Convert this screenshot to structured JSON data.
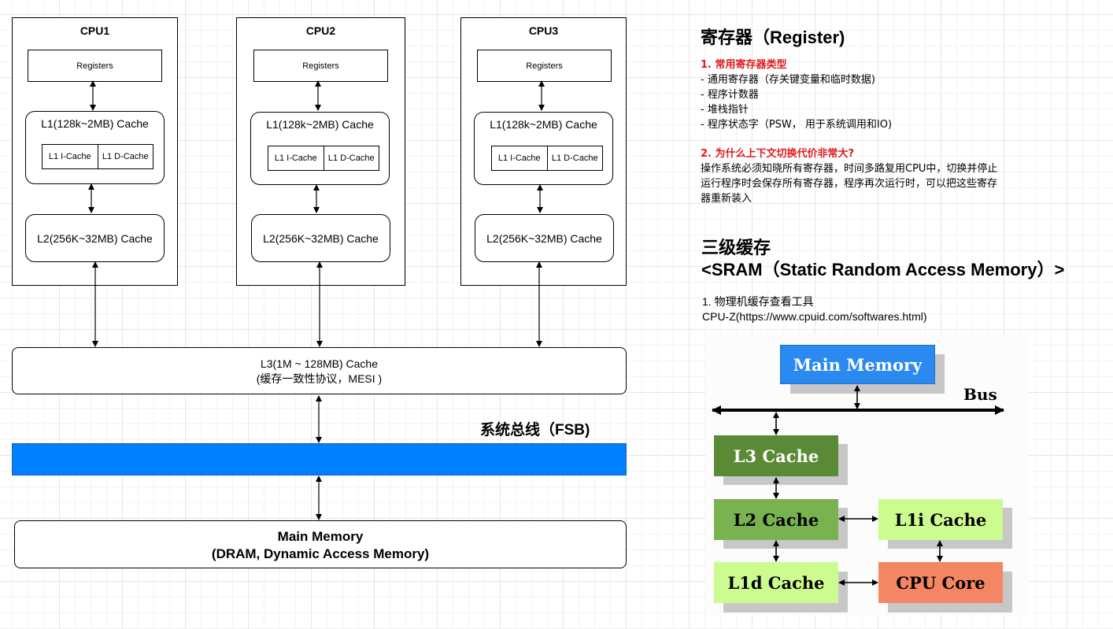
{
  "cpus": [
    {
      "title": "CPU1",
      "registers": "Registers",
      "l1": "L1(128k~2MB) Cache",
      "l1i": "L1 I-Cache",
      "l1d": "L1 D-Cache",
      "l2": "L2(256K~32MB) Cache"
    },
    {
      "title": "CPU2",
      "registers": "Registers",
      "l1": "L1(128k~2MB) Cache",
      "l1i": "L1 I-Cache",
      "l1d": "L1 D-Cache",
      "l2": "L2(256K~32MB) Cache"
    },
    {
      "title": "CPU3",
      "registers": "Registers",
      "l1": "L1(128k~2MB) Cache",
      "l1i": "L1 I-Cache",
      "l1d": "L1 D-Cache",
      "l2": "L2(256K~32MB) Cache"
    }
  ],
  "l3": {
    "line1": "L3(1M ~ 128MB) Cache",
    "line2": "(缓存一致性协议，MESI )"
  },
  "fsb_label": "系统总线（FSB)",
  "main_memory": {
    "line1": "Main Memory",
    "line2": "(DRAM, Dynamic Access Memory)"
  },
  "notes": {
    "register_heading": "寄存器（Register)",
    "sec1_title": "1. 常用寄存器类型",
    "sec1_items": [
      "- 通用寄存器（存关键变量和临时数据)",
      "- 程序计数器",
      "- 堆栈指针",
      "- 程序状态字（PSW，  用于系统调用和IO)"
    ],
    "sec2_title": "2. 为什么上下文切换代价非常大?",
    "sec2_lines": [
      "操作系统必须知晓所有寄存器，时间多路复用CPU中，切换并停止",
      "运行程序时会保存所有寄存器，程序再次运行时，可以把这些寄存",
      "器重新装入"
    ],
    "cache_heading1": "三级缓存",
    "cache_heading2": "<SRAM（Static Random Access Memory）>",
    "tool_line1": "1. 物理机缓存查看工具",
    "tool_line2": "CPU-Z(https://www.cpuid.com/softwares.html)"
  },
  "inset": {
    "main_memory": "Main Memory",
    "bus": "Bus",
    "l3": "L3 Cache",
    "l2": "L2 Cache",
    "l1i": "L1i Cache",
    "l1d": "L1d Cache",
    "cpu_core": "CPU Core",
    "colors": {
      "main_memory": "#2b8af0",
      "l3": "#5a8a36",
      "l2": "#79b250",
      "l1": "#ccfc8f",
      "cpu_core": "#f48663"
    }
  }
}
